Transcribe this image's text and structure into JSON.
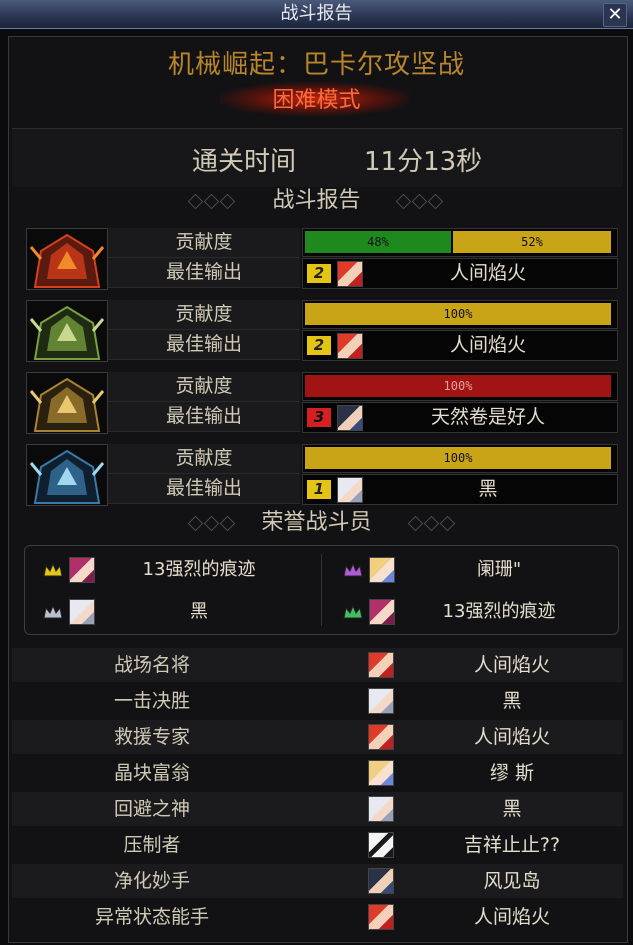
{
  "window": {
    "title": "战斗报告"
  },
  "dungeon": {
    "name": "机械崛起：巴卡尔攻坚战",
    "mode": "困难模式"
  },
  "clear_time": {
    "label": "通关时间",
    "value": "11分13秒"
  },
  "sections": {
    "battle_report": "战斗报告",
    "honor": "荣誉战斗员"
  },
  "stat_labels": {
    "contribution": "贡献度",
    "best_output": "最佳输出"
  },
  "bosses": [
    {
      "icon": "red-boss-portrait",
      "bars": [
        {
          "text": "48%",
          "value": 48,
          "color": "#1e8a1e"
        },
        {
          "text": "52%",
          "value": 52,
          "color": "#c9a417"
        }
      ],
      "rank": "2",
      "rank_color": "#e5c514",
      "rank_text_color": "#222",
      "player": "人间焰火",
      "avatar": "red-hair-avatar"
    },
    {
      "icon": "green-boss-portrait",
      "bars": [
        {
          "text": "100%",
          "value": 100,
          "color": "#c9a417"
        }
      ],
      "rank": "2",
      "rank_color": "#e5c514",
      "rank_text_color": "#222",
      "player": "人间焰火",
      "avatar": "red-hair-avatar"
    },
    {
      "icon": "gold-boss-portrait",
      "bars": [
        {
          "text": "100%",
          "value": 100,
          "color": "#a01414"
        }
      ],
      "rank": "3",
      "rank_color": "#d42020",
      "rank_text_color": "#111",
      "player": "天然卷是好人",
      "avatar": "dark-hair-avatar"
    },
    {
      "icon": "blue-boss-portrait",
      "bars": [
        {
          "text": "100%",
          "value": 100,
          "color": "#c9a417"
        }
      ],
      "rank": "1",
      "rank_color": "#e5c514",
      "rank_text_color": "#222",
      "player": "黑",
      "avatar": "white-hair-avatar"
    }
  ],
  "honor_players": [
    {
      "name": "13强烈的痕迹",
      "crown": "gold-crown-icon",
      "avatar": "pink-avatar"
    },
    {
      "name": "阑珊\"",
      "crown": "purple-crown-icon",
      "avatar": "blonde-avatar"
    },
    {
      "name": "黑",
      "crown": "silver-crown-icon",
      "avatar": "white-hair-avatar"
    },
    {
      "name": "13强烈的痕迹",
      "crown": "green-crown-icon",
      "avatar": "pink-avatar"
    }
  ],
  "awards": [
    {
      "title": "战场名将",
      "player": "人间焰火",
      "avatar": "red-hair-avatar"
    },
    {
      "title": "一击决胜",
      "player": "黑",
      "avatar": "white-hair-avatar"
    },
    {
      "title": "救援专家",
      "player": "人间焰火",
      "avatar": "red-hair-avatar"
    },
    {
      "title": "晶块富翁",
      "player": "缪 斯",
      "avatar": "blonde-avatar"
    },
    {
      "title": "回避之神",
      "player": "黑",
      "avatar": "white-hair-avatar"
    },
    {
      "title": "压制者",
      "player": "吉祥止止??",
      "avatar": "panda-avatar"
    },
    {
      "title": "净化妙手",
      "player": "风见岛",
      "avatar": "dark-hair-avatar"
    },
    {
      "title": "异常状态能手",
      "player": "人间焰火",
      "avatar": "red-hair-avatar"
    }
  ]
}
